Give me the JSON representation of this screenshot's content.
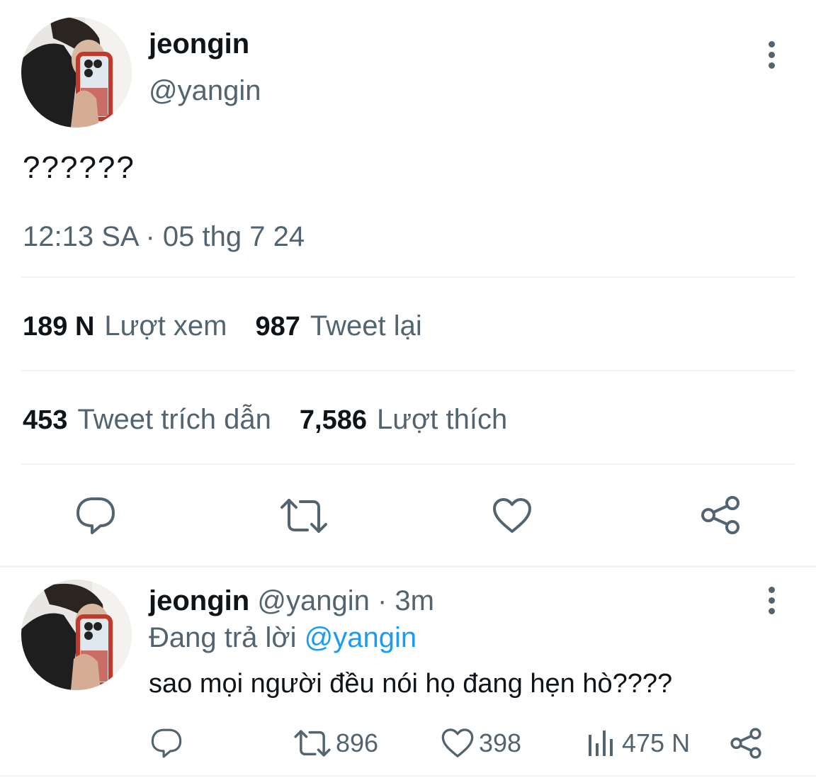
{
  "tweet": {
    "display_name": "jeongin",
    "handle": "@yangin",
    "avatar_icon": "profile-photo-avatar",
    "more_icon": "more-vertical-icon",
    "text": "??????",
    "timestamp": "12:13 SA · 05 thg 7 24",
    "stats": {
      "views_count": "189 N",
      "views_label": "Lượt xem",
      "retweets_count": "987",
      "retweets_label": "Tweet lại",
      "quotes_count": "453",
      "quotes_label": "Tweet trích dẫn",
      "likes_count": "7,586",
      "likes_label": "Lượt thích"
    },
    "actions": [
      "reply-icon",
      "retweet-icon",
      "like-icon",
      "share-icon"
    ]
  },
  "reply": {
    "display_name": "jeongin",
    "handle": "@yangin",
    "time": "· 3m",
    "replying_to_label": "Đang trả lời",
    "replying_to_handle": "@yangin",
    "text": "sao mọi người đều nói họ đang hẹn hò????",
    "retweet_count": "896",
    "like_count": "398",
    "view_count": "475 N"
  },
  "colors": {
    "text_primary": "#0f1419",
    "text_secondary": "#536471",
    "link": "#1d9bf0",
    "divider": "#eff3f4"
  }
}
